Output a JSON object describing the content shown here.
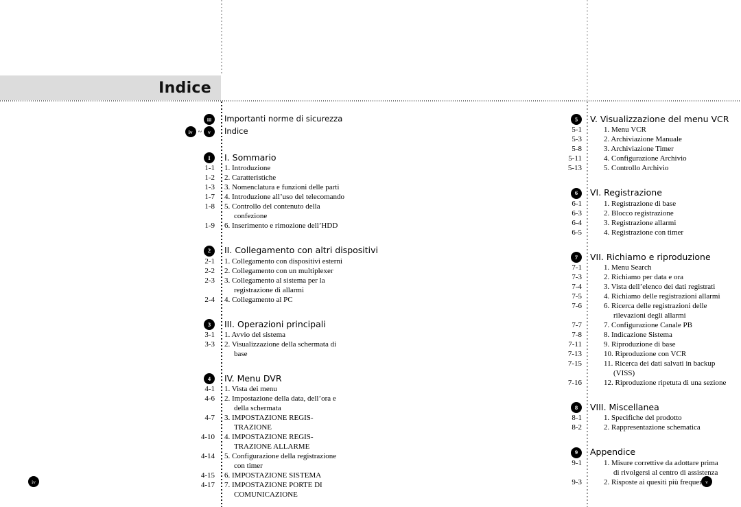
{
  "page": {
    "title": "Indice",
    "folio_left": "iv",
    "folio_right": "v",
    "range_separator": "~"
  },
  "left_column": {
    "front_matter": [
      {
        "marker": "iii",
        "marker_kind": "badge",
        "label": "Importanti norme di sicurezza"
      },
      {
        "marker_from": "iv",
        "marker_to": "v",
        "marker_kind": "badge-range",
        "label": "Indice"
      }
    ],
    "sections": [
      {
        "badge": "I",
        "heading": "I. Sommario",
        "entries": [
          {
            "page": "1-1",
            "text": "1. Introduzione"
          },
          {
            "page": "1-2",
            "text": "2. Caratteristiche"
          },
          {
            "page": "1-3",
            "text": "3. Nomenclatura e funzioni delle parti"
          },
          {
            "page": "1-7",
            "text": "4. Introduzione all’uso del telecomando"
          },
          {
            "page": "1-8",
            "text": "5. Controllo del contenuto della",
            "cont": "confezione"
          },
          {
            "page": "1-9",
            "text": "6. Inserimento e rimozione dell’HDD"
          }
        ]
      },
      {
        "badge": "2",
        "heading": "II. Collegamento con altri dispositivi",
        "entries": [
          {
            "page": "2-1",
            "text": "1. Collegamento con dispositivi esterni"
          },
          {
            "page": "2-2",
            "text": "2. Collegamento con un multiplexer"
          },
          {
            "page": "2-3",
            "text": "3. Collegamento al sistema per la",
            "cont": "registrazione di allarmi"
          },
          {
            "page": "2-4",
            "text": "4. Collegamento al PC"
          }
        ]
      },
      {
        "badge": "3",
        "heading": "III. Operazioni principali",
        "entries": [
          {
            "page": "3-1",
            "text": "1. Avvio del sistema"
          },
          {
            "page": "3-3",
            "text": "2. Visualizzazione della schermata di",
            "cont": "base"
          }
        ]
      },
      {
        "badge": "4",
        "heading": "IV. Menu DVR",
        "entries": [
          {
            "page": "4-1",
            "text": "1. Vista dei menu"
          },
          {
            "page": "4-6",
            "text": "2. Impostazione della data, dell’ora e",
            "cont": "della schermata"
          },
          {
            "page": "4-7",
            "text": "3. IMPOSTAZIONE REGIS-",
            "cont": "TRAZIONE"
          },
          {
            "page": "4-10",
            "text": "4. IMPOSTAZIONE REGIS-",
            "cont": "TRAZIONE ALLARME"
          },
          {
            "page": "4-14",
            "text": "5. Configurazione della registrazione",
            "cont": "con timer"
          },
          {
            "page": "4-15",
            "text": "6. IMPOSTAZIONE SISTEMA"
          },
          {
            "page": "4-17",
            "text": "7. IMPOSTAZIONE PORTE DI",
            "cont": "COMUNICAZIONE"
          }
        ]
      }
    ]
  },
  "right_column": {
    "sections": [
      {
        "badge": "5",
        "heading": "V. Visualizzazione del menu VCR",
        "entries": [
          {
            "page": "5-1",
            "text": "1. Menu VCR"
          },
          {
            "page": "5-3",
            "text": "2. Archiviazione Manuale"
          },
          {
            "page": "5-8",
            "text": "3. Archiviazione Timer"
          },
          {
            "page": "5-11",
            "text": "4. Configurazione Archivio"
          },
          {
            "page": "5-13",
            "text": "5. Controllo Archivio"
          }
        ]
      },
      {
        "badge": "6",
        "heading": "VI. Registrazione",
        "entries": [
          {
            "page": "6-1",
            "text": "1. Registrazione di base"
          },
          {
            "page": "6-3",
            "text": "2. Blocco registrazione"
          },
          {
            "page": "6-4",
            "text": "3. Registrazione allarmi"
          },
          {
            "page": "6-5",
            "text": "4. Registrazione con timer"
          }
        ]
      },
      {
        "badge": "7",
        "heading": "VII. Richiamo e riproduzione",
        "entries": [
          {
            "page": "7-1",
            "text": "1. Menu Search"
          },
          {
            "page": "7-3",
            "text": "2. Richiamo per data e ora"
          },
          {
            "page": "7-4",
            "text": "3. Vista dell’elenco dei dati registrati"
          },
          {
            "page": "7-5",
            "text": "4. Richiamo delle registrazioni allarmi"
          },
          {
            "page": "7-6",
            "text": "6. Ricerca delle registrazioni delle",
            "cont": "rilevazioni degli allarmi"
          },
          {
            "page": "7-7",
            "text": "7. Configurazione Canale PB"
          },
          {
            "page": "7-8",
            "text": "8. Indicazione Sistema"
          },
          {
            "page": "7-11",
            "text": "9. Riproduzione di base"
          },
          {
            "page": "7-13",
            "text": "10. Riproduzione con VCR"
          },
          {
            "page": "7-15",
            "text": "11. Ricerca dei dati salvati in backup",
            "cont": "(VISS)"
          },
          {
            "page": "7-16",
            "text": "12. Riproduzione ripetuta di una sezione"
          }
        ]
      },
      {
        "badge": "8",
        "heading": "VIII. Miscellanea",
        "entries": [
          {
            "page": "8-1",
            "text": "1. Specifiche del prodotto"
          },
          {
            "page": "8-2",
            "text": "2. Rappresentazione schematica"
          }
        ]
      },
      {
        "badge": "9",
        "heading": "Appendice",
        "entries": [
          {
            "page": "9-1",
            "text": "1. Misure correttive da adottare prima",
            "cont": "di rivolgersi al centro di assistenza"
          },
          {
            "page": "9-3",
            "text": "2. Risposte ai quesiti più frequenti"
          }
        ]
      }
    ]
  }
}
